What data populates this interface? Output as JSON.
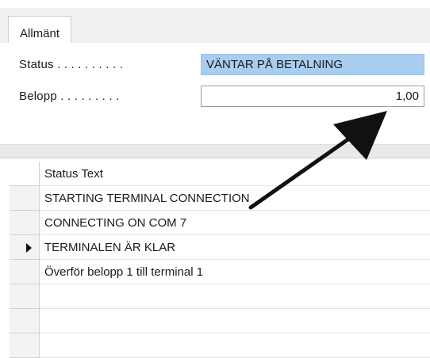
{
  "tabs": [
    {
      "label": "Allmänt"
    }
  ],
  "form": {
    "status_label": "Status . . . . . . . . . .",
    "status_value": "VÄNTAR PÅ BETALNING",
    "amount_label": "Belopp . . . . . . . . .",
    "amount_value": "1,00"
  },
  "grid": {
    "header": "Status Text",
    "rows": [
      {
        "text": "STARTING TERMINAL CONNECTION",
        "current": false
      },
      {
        "text": "CONNECTING ON COM 7",
        "current": false
      },
      {
        "text": "TERMINALEN ÄR KLAR",
        "current": true
      },
      {
        "text": "Överför belopp 1 till terminal 1",
        "current": false
      },
      {
        "text": "",
        "current": false
      },
      {
        "text": "",
        "current": false
      },
      {
        "text": "",
        "current": false
      }
    ]
  },
  "colors": {
    "status_highlight": "#a9cdef",
    "annotation_arrow": "#111111"
  }
}
